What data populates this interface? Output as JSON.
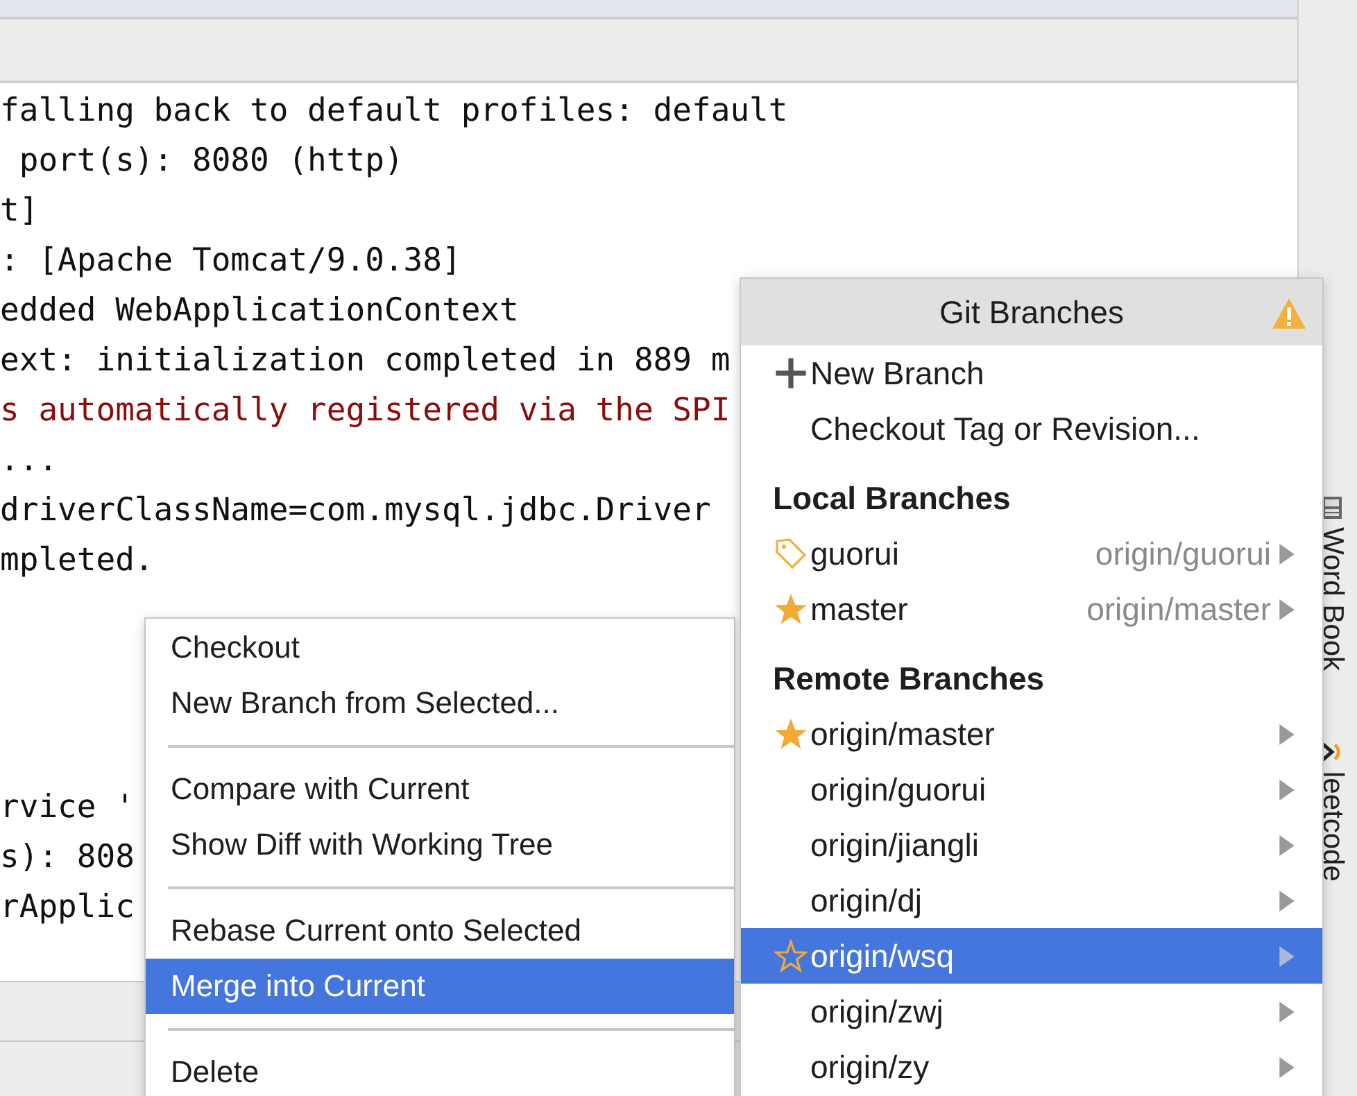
{
  "console": {
    "lines": [
      {
        "text": "falling back to default profiles: default",
        "kind": "info"
      },
      {
        "text": " port(s): 8080 (http)",
        "kind": "info"
      },
      {
        "text": "t]",
        "kind": "info"
      },
      {
        "text": ": [Apache Tomcat/9.0.38]",
        "kind": "info"
      },
      {
        "text": "edded WebApplicationContext",
        "kind": "info"
      },
      {
        "text": "ext: initialization completed in 889 m",
        "kind": "info"
      },
      {
        "text": "s automatically registered via the SPI",
        "kind": "error"
      },
      {
        "text": "...",
        "kind": "info"
      },
      {
        "text": "driverClassName=com.mysql.jdbc.Driver",
        "kind": "info"
      },
      {
        "text": "mpleted.",
        "kind": "info"
      }
    ],
    "lower_lines": [
      {
        "text": "rvice '"
      },
      {
        "text": "s): 808"
      },
      {
        "text": "rApplic"
      }
    ]
  },
  "tool_windows": [
    {
      "label": "Word Book",
      "kind": "book"
    },
    {
      "label": "leetcode",
      "kind": "code"
    }
  ],
  "context_menu": {
    "groups": [
      [
        {
          "label": "Checkout",
          "selected": false
        },
        {
          "label": "New Branch from Selected...",
          "selected": false
        }
      ],
      [
        {
          "label": "Compare with Current",
          "selected": false
        },
        {
          "label": "Show Diff with Working Tree",
          "selected": false
        }
      ],
      [
        {
          "label": "Rebase Current onto Selected",
          "selected": false
        },
        {
          "label": "Merge into Current",
          "selected": true
        }
      ],
      [
        {
          "label": "Delete",
          "selected": false
        }
      ]
    ]
  },
  "git_branches": {
    "title": "Git Branches",
    "actions": [
      {
        "label": "New Branch",
        "kind": "add"
      },
      {
        "label": "Checkout Tag or Revision...",
        "kind": "plain"
      }
    ],
    "sections": [
      {
        "heading": "Local Branches",
        "branches": [
          {
            "name": "guorui",
            "tracking": "origin/guorui",
            "kind": "tag",
            "selected": false
          },
          {
            "name": "master",
            "tracking": "origin/master",
            "kind": "star",
            "selected": false
          }
        ]
      },
      {
        "heading": "Remote Branches",
        "branches": [
          {
            "name": "origin/master",
            "kind": "star",
            "selected": false
          },
          {
            "name": "origin/guorui",
            "kind": "plain",
            "selected": false
          },
          {
            "name": "origin/jiangli",
            "kind": "plain",
            "selected": false
          },
          {
            "name": "origin/dj",
            "kind": "plain",
            "selected": false
          },
          {
            "name": "origin/wsq",
            "kind": "star-outline",
            "selected": true
          },
          {
            "name": "origin/zwj",
            "kind": "plain",
            "selected": false
          },
          {
            "name": "origin/zy",
            "kind": "plain",
            "selected": false
          }
        ]
      }
    ]
  }
}
